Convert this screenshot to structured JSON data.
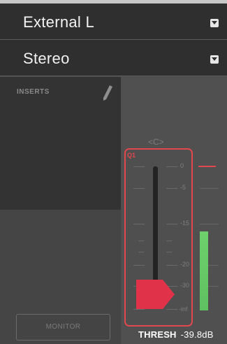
{
  "channel": {
    "input_label": "External L",
    "mode_label": "Stereo"
  },
  "inserts": {
    "title": "INSERTS",
    "edit_icon": "pencil-icon"
  },
  "monitor": {
    "label": "MONITOR"
  },
  "fader": {
    "pan_label": "<C>",
    "channel_tag": "Q1",
    "scale_labels": [
      "0",
      "-5",
      "-15",
      "-20",
      "-30",
      "-inf"
    ]
  },
  "meter": {
    "level_fraction": 0.52
  },
  "threshold": {
    "label": "THRESH",
    "value": "-39.8dB"
  },
  "colors": {
    "accent": "#e0474e",
    "meter": "#6ed06c",
    "panel_dark": "#2f2f2f"
  }
}
